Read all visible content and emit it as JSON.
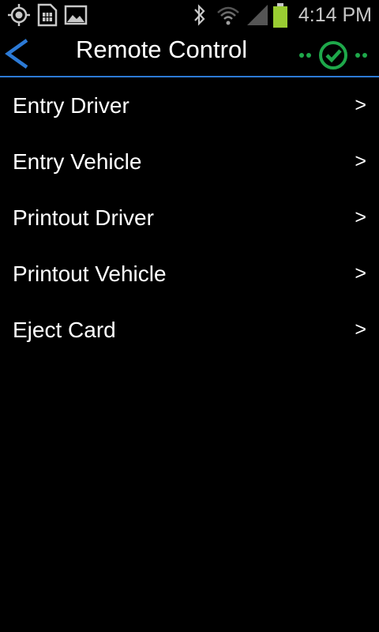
{
  "status_bar": {
    "time": "4:14 PM",
    "icons": [
      "location-icon",
      "sim-card-icon",
      "image-icon",
      "bluetooth-icon",
      "wifi-icon",
      "signal-icon",
      "battery-icon"
    ]
  },
  "action_bar": {
    "title": "Remote Control",
    "back_icon": "chevron-left-icon",
    "status_icon": "connected-check-icon"
  },
  "colors": {
    "background": "#000000",
    "accent_blue": "#2c7ad6",
    "connected_green": "#1ea84a",
    "battery_green": "#9acd32"
  },
  "menu": {
    "items": [
      {
        "label": "Entry Driver",
        "chevron": ">"
      },
      {
        "label": "Entry Vehicle",
        "chevron": ">"
      },
      {
        "label": "Printout Driver",
        "chevron": ">"
      },
      {
        "label": "Printout Vehicle",
        "chevron": ">"
      },
      {
        "label": "Eject Card",
        "chevron": ">"
      }
    ]
  }
}
